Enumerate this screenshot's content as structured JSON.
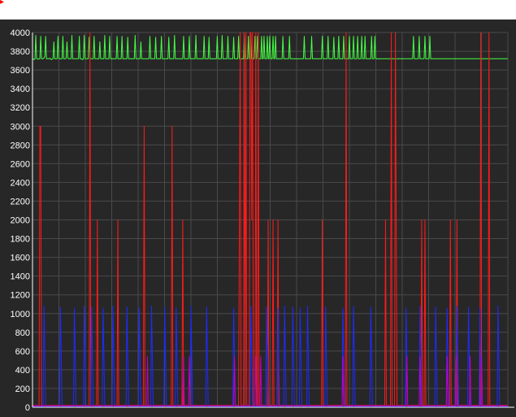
{
  "ui": {
    "corner_mark": "▸"
  },
  "colors": {
    "panel_bg": "#272727",
    "grid": "#4a4a4a",
    "axis": "#ffffff",
    "green": "#44ff44",
    "red": "#ff1a1a",
    "blue": "#1f2bff",
    "magenta": "#c000c0"
  },
  "chart_data": {
    "type": "line",
    "title": "",
    "xlabel": "",
    "ylabel": "",
    "ylim": [
      0,
      4000
    ],
    "yticks": [
      0,
      200,
      400,
      600,
      800,
      1000,
      1200,
      1400,
      1600,
      1800,
      2000,
      2200,
      2400,
      2600,
      2800,
      3000,
      3200,
      3400,
      3600,
      3800,
      4000
    ],
    "grid": true,
    "x_count": 580,
    "series": [
      {
        "color": "green",
        "values": [
          3720,
          3720,
          3710,
          3720,
          3970,
          3720,
          3720,
          3715,
          3720,
          3720,
          3960,
          3720,
          3720,
          3720,
          3730,
          3740,
          3960,
          3720,
          3720,
          3720,
          3720,
          3725,
          3720,
          3710,
          3720,
          3720,
          3900,
          3720,
          3720,
          3720,
          3720,
          3960,
          3720,
          3720,
          3720,
          3720,
          3720,
          3960,
          3720,
          3720,
          3720,
          3725,
          3900,
          3730,
          3720,
          3720,
          3720,
          3720,
          3970,
          3720,
          3720,
          3720,
          3720,
          3720,
          3720,
          3720,
          3720,
          3960,
          3720,
          3720,
          3720,
          3710,
          3720,
          3970,
          3720,
          3720,
          3720,
          3720,
          3720,
          3950,
          3730,
          3720,
          3720,
          3720,
          3720,
          3960,
          3720,
          3720,
          3720,
          3720,
          3720,
          3720,
          3900,
          3720,
          3720,
          3720,
          3720,
          3720,
          3970,
          3720,
          3720,
          3720,
          3720,
          3720,
          3960,
          3720,
          3720,
          3720,
          3720,
          3720,
          3720,
          3720,
          3720,
          3960,
          3720,
          3720,
          3720,
          3720,
          3720,
          3960,
          3720,
          3720,
          3720,
          3720,
          3720,
          3720,
          3950,
          3720,
          3720,
          3720,
          3720,
          3720,
          3720,
          3720,
          3720,
          3970,
          3720,
          3720,
          3720,
          3720,
          3720,
          3720,
          3900,
          3720,
          3720,
          3720,
          3720,
          3720,
          3720,
          3720,
          3720,
          3720,
          3720,
          3960,
          3720,
          3720,
          3720,
          3720,
          3720,
          3720,
          3950,
          3720,
          3720,
          3720,
          3720,
          3720,
          3720,
          3960,
          3720,
          3720,
          3720,
          3720,
          3720,
          3720,
          3720,
          3720,
          3950,
          3720,
          3720,
          3720,
          3720,
          3720,
          3720,
          3970,
          3720,
          3720,
          3720,
          3720,
          3720,
          3720,
          3720,
          3720,
          3720,
          3720,
          3960,
          3720,
          3720,
          3720,
          3720,
          3720,
          3720,
          3960,
          3720,
          3720,
          3720,
          3720,
          3720,
          3720,
          3720,
          3970,
          3720,
          3720,
          3720,
          3720,
          3720,
          3720,
          3720,
          3720,
          3720,
          3960,
          3720,
          3720,
          3720,
          3720,
          3720,
          3950,
          3720,
          3720,
          3720,
          3720,
          3720,
          3720,
          3720,
          3720,
          3720,
          3960,
          3720,
          3720,
          3720,
          3720,
          3720,
          3970,
          3720,
          3720,
          3720,
          3720,
          3720,
          3720,
          3960,
          3720,
          3720,
          3720,
          3720,
          3720,
          3720,
          3950,
          3720,
          3720,
          3720,
          3720,
          3720,
          3960,
          3720,
          3720,
          3720,
          3720,
          3720,
          3720,
          3960,
          3720,
          3720,
          3720,
          3720,
          3960,
          3720,
          3720,
          3960,
          3720,
          3720,
          3720,
          3720,
          3960,
          3720,
          3720,
          3960,
          3720,
          3720,
          3720,
          3720,
          3960,
          3720,
          3720,
          3960,
          3720,
          3720,
          3720,
          3960,
          3720,
          3720,
          3960,
          3720,
          3720,
          3720,
          3960,
          3720,
          3720,
          3960,
          3720,
          3720,
          3720,
          3720,
          3720,
          3720,
          3720,
          3720,
          3960,
          3720,
          3720,
          3720,
          3720,
          3720,
          3720,
          3720,
          3960,
          3720,
          3720,
          3720,
          3720,
          3720,
          3720,
          3720,
          3720,
          3720,
          3720,
          3720,
          3720,
          3720,
          3720,
          3720,
          3720,
          3720,
          3960,
          3720,
          3720,
          3720,
          3720,
          3720,
          3720,
          3720,
          3720,
          3960,
          3720,
          3720,
          3720,
          3720,
          3720,
          3720,
          3720,
          3720,
          3720,
          3720,
          3720,
          3720,
          3960,
          3720,
          3720,
          3720,
          3720,
          3720,
          3720,
          3960,
          3720,
          3720,
          3720,
          3720,
          3720,
          3720,
          3950,
          3720,
          3720,
          3720,
          3720,
          3720,
          3960,
          3720,
          3720,
          3720,
          3720,
          3720,
          3960,
          3720,
          3720,
          3720,
          3720,
          3720,
          3720,
          3960,
          3720,
          3720,
          3720,
          3720,
          3960,
          3720,
          3720,
          3720,
          3720,
          3960,
          3720,
          3720,
          3720,
          3720,
          3960,
          3720,
          3720,
          3720,
          3960,
          3720,
          3720,
          3720,
          3720,
          3720,
          3720,
          3720,
          3960,
          3720,
          3720,
          3720,
          3960,
          3720,
          3720,
          3720,
          3720,
          3720,
          3720,
          3720,
          3720,
          3720,
          3720,
          3720,
          3720,
          3720,
          3720,
          3720,
          3720,
          3720,
          3720,
          3720,
          3720,
          3720,
          3720,
          3720,
          3720,
          3720,
          3720,
          3720,
          3720,
          3720,
          3720,
          3720,
          3720,
          3720,
          3720,
          3720,
          3720,
          3720,
          3720,
          3720,
          3720,
          3720,
          3720,
          3720,
          3720,
          3720,
          3720,
          3960,
          3720,
          3720,
          3720,
          3720,
          3720,
          3720,
          3960,
          3720,
          3720,
          3720,
          3720,
          3720,
          3720,
          3960,
          3720,
          3720,
          3720,
          3720,
          3720,
          3960,
          3720,
          3720,
          3720,
          3720,
          3720,
          3720,
          3720,
          3720,
          3720,
          3720,
          3720,
          3720,
          3720,
          3720,
          3720,
          3720,
          3720,
          3720,
          3720,
          3720,
          3720,
          3720,
          3720,
          3720,
          3720,
          3720,
          3720,
          3720,
          3720,
          3720,
          3720,
          3720,
          3720,
          3720,
          3720,
          3720,
          3720,
          3720,
          3720,
          3720,
          3720,
          3720,
          3720,
          3720,
          3720,
          3720,
          3720,
          3720,
          3720,
          3720,
          3720,
          3720,
          3720,
          3720,
          3720,
          3720,
          3720,
          3720,
          3720,
          3720,
          3720,
          3720,
          3720,
          3720,
          3720,
          3720,
          3720,
          3720,
          3720,
          3720,
          3720,
          3720,
          3720,
          3720,
          3720,
          3720,
          3720,
          3720,
          3720,
          3720,
          3720,
          3720,
          3720,
          3720,
          3720,
          3720,
          3720,
          3720,
          3720,
          3720,
          3720,
          3720,
          3720,
          3720,
          3720
        ]
      },
      {
        "color": "red",
        "values": []
      },
      {
        "color": "blue",
        "values": []
      },
      {
        "color": "magenta",
        "values": []
      }
    ]
  }
}
